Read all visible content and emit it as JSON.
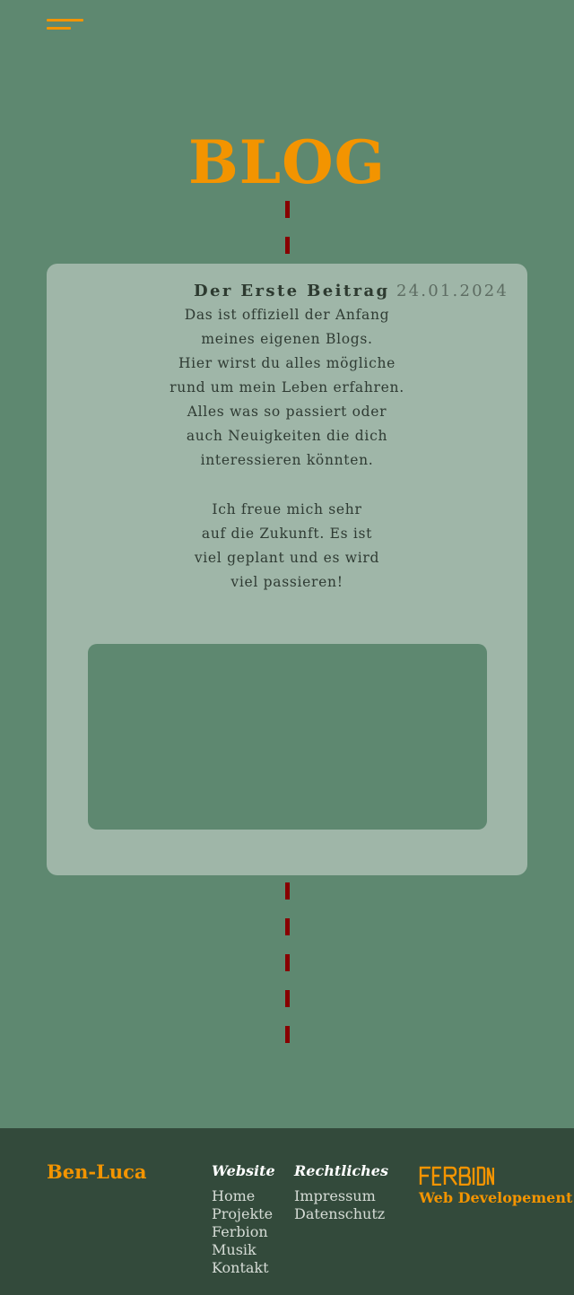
{
  "header": {
    "menu_icon": "hamburger-menu-icon"
  },
  "page": {
    "title": "BLOG"
  },
  "post": {
    "title": "Der Erste Beitrag",
    "date": "24.01.2024",
    "paragraph1_lines": [
      "Das ist offiziell der Anfang",
      "meines eigenen Blogs.",
      "Hier wirst du alles mögliche",
      "rund um mein Leben erfahren.",
      "Alles was so passiert oder",
      "auch Neuigkeiten die dich",
      "interessieren könnten."
    ],
    "paragraph2_lines": [
      "Ich freue mich sehr",
      "auf die Zukunft. Es ist",
      "viel geplant und es wird",
      "viel passieren!"
    ]
  },
  "footer": {
    "brand": "Ben-Luca",
    "website": {
      "heading": "Website",
      "links": [
        "Home",
        "Projekte",
        "Ferbion",
        "Musik",
        "Kontakt"
      ]
    },
    "legal": {
      "heading": "Rechtliches",
      "links": [
        "Impressum",
        "Datenschutz"
      ]
    },
    "partner": {
      "logo_text": "FERBION",
      "subtitle": "Web Developement"
    }
  },
  "colors": {
    "background": "#5e8870",
    "accent": "#f39400",
    "card": "#9fb6a8",
    "timeline_dash": "#870000",
    "footer": "#334a3b"
  }
}
